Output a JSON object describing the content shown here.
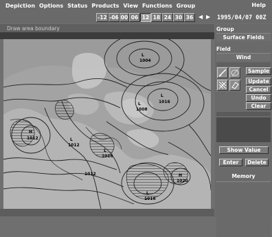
{
  "menubar": {
    "items": [
      "Depiction",
      "Options",
      "Status",
      "Products",
      "View",
      "Functions",
      "Group"
    ],
    "help": "Help"
  },
  "timebar": {
    "buttons": [
      "-12",
      "-06",
      "00",
      "06",
      "12",
      "18",
      "24",
      "30",
      "36"
    ],
    "active": "12",
    "prev_arrow": "◀",
    "next_arrow": "▶",
    "datetime": "1995/04/07 00Z"
  },
  "status": {
    "message": "Draw area boundary"
  },
  "map": {
    "pressure_labels": [
      "1004",
      "1016",
      "1012",
      "1008",
      "1012",
      "1016",
      "1020",
      "1016",
      "1012"
    ],
    "center_labels": [
      "L",
      "L",
      "H",
      "L",
      "L",
      "L",
      "H",
      "L"
    ]
  },
  "panel": {
    "group_label": "Group",
    "group_value": "Surface Fields",
    "field_label": "Field",
    "field_value": "Wind",
    "buttons": {
      "sample": "Sample",
      "update": "Update",
      "cancel": "Cancel",
      "undo": "Undo",
      "clear": "Clear",
      "show_value": "Show Value",
      "enter": "Enter",
      "delete": "Delete"
    },
    "memory_label": "Memory"
  },
  "colors": {
    "background": "#6f6f6f",
    "map_land": "#a9a9a9",
    "contour": "#1e1e1e",
    "hatch": "#222222"
  }
}
